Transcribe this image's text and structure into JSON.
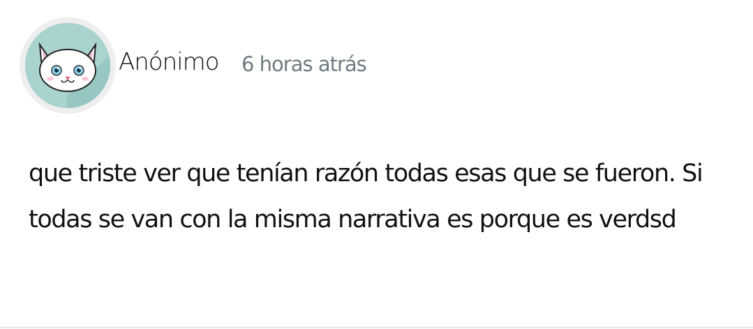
{
  "comment": {
    "author": "Anónimo",
    "time": "6 horas atrás",
    "text": "que triste ver que tenían razón todas esas que se fueron. Si todas se van con la misma narrativa es porque es verdsd",
    "avatar": {
      "icon": "white-cat-avatar",
      "background_color": "#a9d3cf"
    }
  },
  "colors": {
    "author": "#111111",
    "time": "#6f7b80",
    "divider": "#e4e4e4"
  }
}
